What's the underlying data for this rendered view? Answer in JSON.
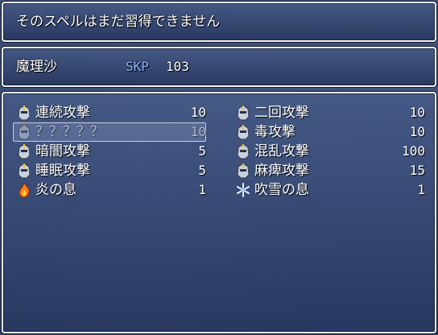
{
  "message": "そのスペルはまだ習得できません",
  "character": {
    "name": "魔理沙",
    "skp_label": "SKP",
    "skp_value": "103"
  },
  "skills_left": [
    {
      "name": "連続攻撃",
      "cost": "10",
      "icon": "knight-helmet-icon",
      "disabled": false
    },
    {
      "name": "？？？？？",
      "cost": "10",
      "icon": "knight-helmet-icon",
      "disabled": true,
      "selected": true
    },
    {
      "name": "暗闇攻撃",
      "cost": "5",
      "icon": "knight-helmet-icon",
      "disabled": false
    },
    {
      "name": "睡眠攻撃",
      "cost": "5",
      "icon": "knight-helmet-icon",
      "disabled": false
    },
    {
      "name": "炎の息",
      "cost": "1",
      "icon": "fire-icon",
      "disabled": false
    }
  ],
  "skills_right": [
    {
      "name": "二回攻撃",
      "cost": "10",
      "icon": "knight-helmet-icon",
      "disabled": false
    },
    {
      "name": "毒攻撃",
      "cost": "10",
      "icon": "knight-helmet-icon",
      "disabled": false
    },
    {
      "name": "混乱攻撃",
      "cost": "100",
      "icon": "knight-helmet-icon",
      "disabled": false
    },
    {
      "name": "麻痺攻撃",
      "cost": "15",
      "icon": "knight-helmet-icon",
      "disabled": false
    },
    {
      "name": "吹雪の息",
      "cost": "1",
      "icon": "snowflake-icon",
      "disabled": false
    }
  ],
  "colors": {
    "window_top": "#465a87",
    "window_bottom": "#28375f",
    "skp_label": "#8cb4ff",
    "fire": "#ff7a1a",
    "ice": "#e8f0ff"
  }
}
